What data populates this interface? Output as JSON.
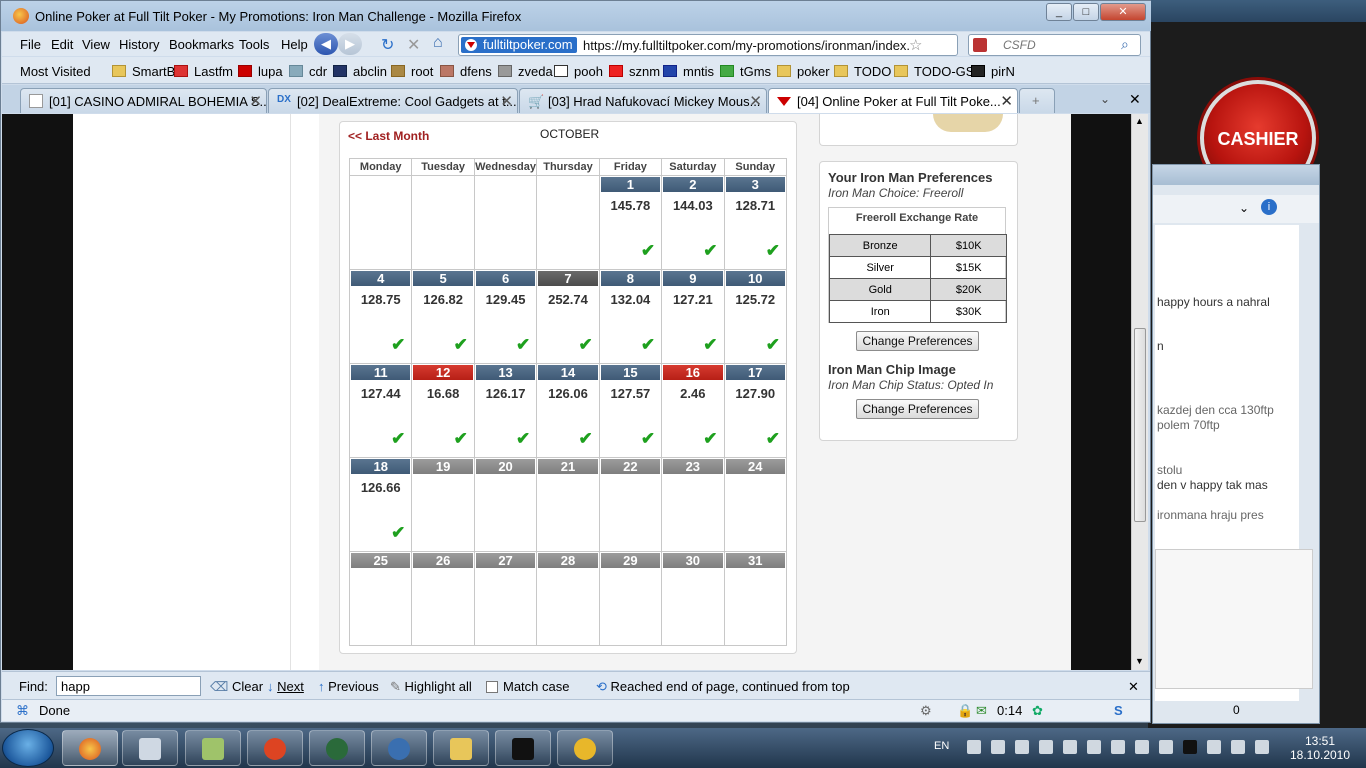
{
  "window": {
    "title": "Online Poker at Full Tilt Poker - My Promotions: Iron Man Challenge - Mozilla Firefox"
  },
  "menu": [
    "File",
    "Edit",
    "View",
    "History",
    "Bookmarks",
    "Tools",
    "Help"
  ],
  "url": {
    "site_badge": "fulltiltpoker.com",
    "value": "https://my.fulltiltpoker.com/my-promotions/ironman/index."
  },
  "search": {
    "placeholder": "CSFD"
  },
  "bookmarks": [
    "Most Visited",
    "SmartB",
    "Lastfm",
    "lupa",
    "cdr",
    "abclin",
    "root",
    "dfens",
    "zveda",
    "pooh",
    "sznm",
    "mntis",
    "tGms",
    "poker",
    "TODO",
    "TODO-GS",
    "pirN"
  ],
  "tabs": [
    {
      "label": "[01] CASINO ADMIRAL BOHEMIA S..."
    },
    {
      "label": "[02] DealExtreme: Cool Gadgets at t..."
    },
    {
      "label": "[03] Hrad Nafukovací Mickey Mous..."
    },
    {
      "label": "[04] Online Poker at Full Tilt Poke..."
    }
  ],
  "calendar": {
    "last_month": "<< Last Month",
    "month": "OCTOBER",
    "weekdays": [
      "Monday",
      "Tuesday",
      "Wednesday",
      "Thursday",
      "Friday",
      "Saturday",
      "Sunday"
    ],
    "weeks": [
      [
        {
          "day": "",
          "value": "",
          "status": "empty",
          "check": false
        },
        {
          "day": "",
          "value": "",
          "status": "empty",
          "check": false
        },
        {
          "day": "",
          "value": "",
          "status": "empty",
          "check": false
        },
        {
          "day": "",
          "value": "",
          "status": "empty",
          "check": false
        },
        {
          "day": "1",
          "value": "145.78",
          "status": "blue",
          "check": true
        },
        {
          "day": "2",
          "value": "144.03",
          "status": "blue",
          "check": true
        },
        {
          "day": "3",
          "value": "128.71",
          "status": "blue",
          "check": true
        }
      ],
      [
        {
          "day": "4",
          "value": "128.75",
          "status": "blue",
          "check": true
        },
        {
          "day": "5",
          "value": "126.82",
          "status": "blue",
          "check": true
        },
        {
          "day": "6",
          "value": "129.45",
          "status": "blue",
          "check": true
        },
        {
          "day": "7",
          "value": "252.74",
          "status": "dark",
          "check": true
        },
        {
          "day": "8",
          "value": "132.04",
          "status": "blue",
          "check": true
        },
        {
          "day": "9",
          "value": "127.21",
          "status": "blue",
          "check": true
        },
        {
          "day": "10",
          "value": "125.72",
          "status": "blue",
          "check": true
        }
      ],
      [
        {
          "day": "11",
          "value": "127.44",
          "status": "blue",
          "check": true
        },
        {
          "day": "12",
          "value": "16.68",
          "status": "red",
          "check": true
        },
        {
          "day": "13",
          "value": "126.17",
          "status": "blue",
          "check": true
        },
        {
          "day": "14",
          "value": "126.06",
          "status": "blue",
          "check": true
        },
        {
          "day": "15",
          "value": "127.57",
          "status": "blue",
          "check": true
        },
        {
          "day": "16",
          "value": "2.46",
          "status": "red",
          "check": true
        },
        {
          "day": "17",
          "value": "127.90",
          "status": "blue",
          "check": true
        }
      ],
      [
        {
          "day": "18",
          "value": "126.66",
          "status": "blue",
          "check": true
        },
        {
          "day": "19",
          "value": "",
          "status": "grey",
          "check": false
        },
        {
          "day": "20",
          "value": "",
          "status": "grey",
          "check": false
        },
        {
          "day": "21",
          "value": "",
          "status": "grey",
          "check": false
        },
        {
          "day": "22",
          "value": "",
          "status": "grey",
          "check": false
        },
        {
          "day": "23",
          "value": "",
          "status": "grey",
          "check": false
        },
        {
          "day": "24",
          "value": "",
          "status": "grey",
          "check": false
        }
      ],
      [
        {
          "day": "25",
          "value": "",
          "status": "grey",
          "check": false
        },
        {
          "day": "26",
          "value": "",
          "status": "grey",
          "check": false
        },
        {
          "day": "27",
          "value": "",
          "status": "grey",
          "check": false
        },
        {
          "day": "28",
          "value": "",
          "status": "grey",
          "check": false
        },
        {
          "day": "29",
          "value": "",
          "status": "grey",
          "check": false
        },
        {
          "day": "30",
          "value": "",
          "status": "grey",
          "check": false
        },
        {
          "day": "31",
          "value": "",
          "status": "grey",
          "check": false
        }
      ]
    ]
  },
  "prefs": {
    "title": "Your Iron Man Preferences",
    "choice": "Iron Man Choice: Freeroll",
    "rate_title": "Freeroll Exchange Rate",
    "rates": [
      {
        "tier": "Bronze",
        "amount": "$10K"
      },
      {
        "tier": "Silver",
        "amount": "$15K"
      },
      {
        "tier": "Gold",
        "amount": "$20K"
      },
      {
        "tier": "Iron",
        "amount": "$30K"
      }
    ],
    "change_label": "Change Preferences",
    "chip_title": "Iron Man Chip Image",
    "chip_status": "Iron Man Chip Status: Opted In",
    "change_label_2": "Change Preferences"
  },
  "find": {
    "label": "Find:",
    "value": "happ",
    "clear": "Clear",
    "next": "Next",
    "previous": "Previous",
    "highlight": "Highlight all",
    "match_case": "Match case",
    "message": "Reached end of page, continued from top"
  },
  "status": {
    "text": "Done",
    "timer": "0:14"
  },
  "bgapp": {
    "cashier": "CASHIER",
    "chat_lines": [
      "happy hours a nahral",
      "n",
      "kazdej den cca 130ftp",
      "polem 70ftp",
      "stolu",
      "den v happy tak mas",
      "ironmana hraju pres"
    ],
    "counter": "0"
  },
  "taskbar": {
    "lang": "EN",
    "time": "13:51",
    "date": "18.10.2010"
  }
}
